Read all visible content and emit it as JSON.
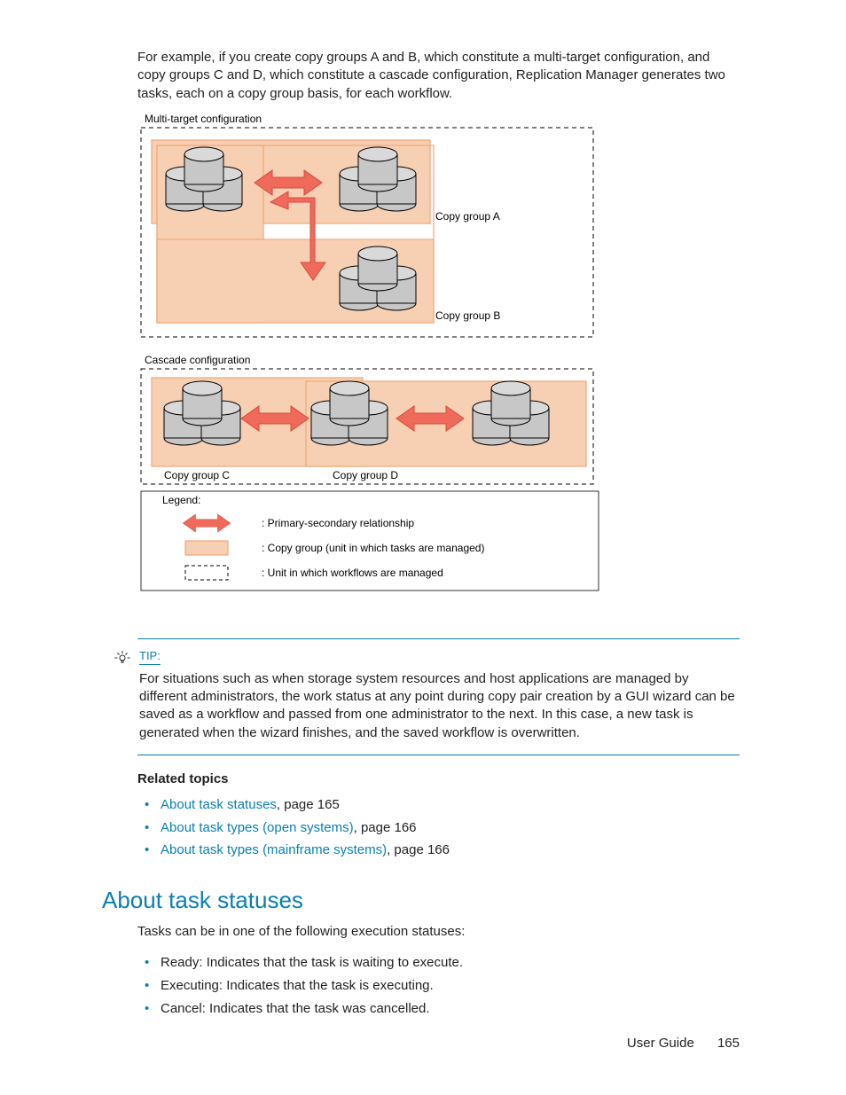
{
  "intro_para": "For example, if you create copy groups A and B, which constitute a multi-target configuration, and copy groups C and D, which constitute a cascade configuration, Replication Manager generates two tasks, each on a copy group basis, for each workflow.",
  "diagram": {
    "multi_target_title": "Multi-target configuration",
    "copy_group_a": "Copy group A",
    "copy_group_b": "Copy group B",
    "cascade_title": "Cascade configuration",
    "copy_group_c": "Copy group C",
    "copy_group_d": "Copy group D",
    "legend_title": "Legend:",
    "legend_arrow": ": Primary-secondary relationship",
    "legend_solid": ": Copy group (unit in which tasks are managed)",
    "legend_dashed": ": Unit in which workflows are managed"
  },
  "tip": {
    "label": "TIP:",
    "body": "For situations such as when storage system resources and host applications are managed by different administrators, the work status at any point during copy pair creation by a GUI wizard can be saved as a workflow and passed from one administrator to the next. In this case, a new task is generated when the wizard finishes, and the saved workflow is overwritten."
  },
  "related": {
    "heading": "Related topics",
    "items": [
      {
        "link": "About task statuses",
        "suffix": ", page 165"
      },
      {
        "link": "About task types (open systems)",
        "suffix": ", page 166"
      },
      {
        "link": "About task types (mainframe systems)",
        "suffix": ", page 166"
      }
    ]
  },
  "section": {
    "title": "About task statuses",
    "intro": "Tasks can be in one of the following execution statuses:",
    "statuses": [
      "Ready: Indicates that the task is waiting to execute.",
      "Executing: Indicates that the task is executing.",
      "Cancel: Indicates that the task was cancelled."
    ]
  },
  "footer": {
    "doc": "User Guide",
    "page": "165"
  }
}
